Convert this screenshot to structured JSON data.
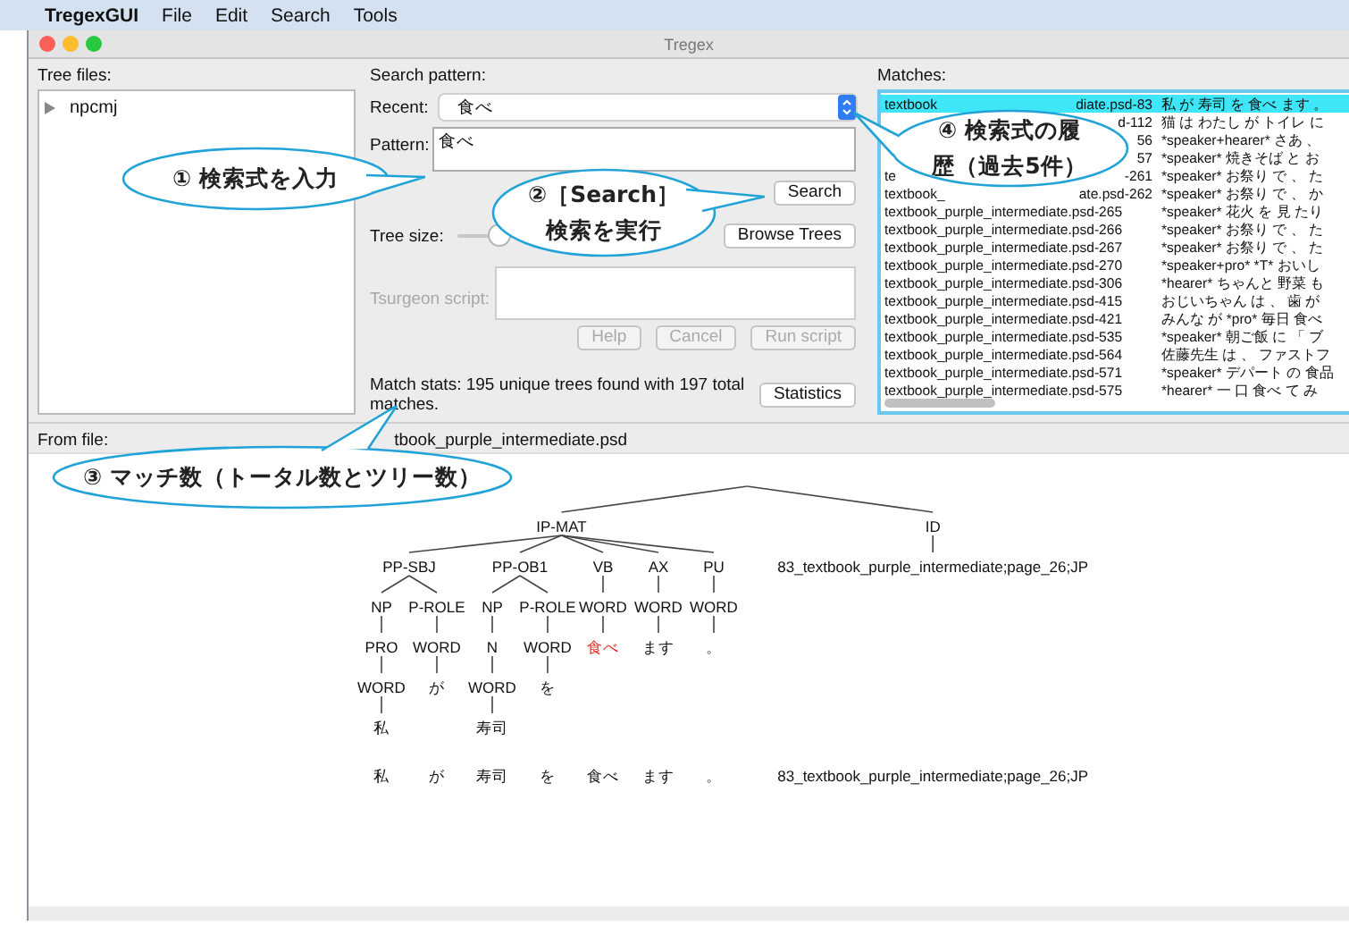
{
  "menu_bar": {
    "app": "TregexGUI",
    "items": [
      "File",
      "Edit",
      "Search",
      "Tools"
    ]
  },
  "window": {
    "title": "Tregex"
  },
  "tree_files": {
    "label": "Tree files:",
    "items": [
      {
        "name": "npcmj",
        "expanded": false
      }
    ]
  },
  "search": {
    "label": "Search pattern:",
    "recent_label": "Recent:",
    "recent_value": "食べ",
    "pattern_label": "Pattern:",
    "pattern_value": "食べ",
    "search_button": "Search",
    "tree_size_label": "Tree size:",
    "tree_size": {
      "level": 0.15
    },
    "browse_button": "Browse Trees",
    "tsurgeon_label": "Tsurgeon script:",
    "tsurgeon_disabled": true,
    "buttons": [
      {
        "label": "Help",
        "disabled": true
      },
      {
        "label": "Cancel",
        "disabled": true
      },
      {
        "label": "Run script",
        "disabled": true
      }
    ],
    "match_stats": "Match stats: 195 unique trees found with 197 total matches.",
    "statistics_button": "Statistics"
  },
  "matches": {
    "label": "Matches:",
    "rows": [
      {
        "head": "textbook",
        "tail": "diate.psd-83",
        "sentence": "私 が 寿司 を 食べ ます 。",
        "selected": true
      },
      {
        "tail": "d-112",
        "sentence": "猫 は わたし が トイレ に",
        "selected": false
      },
      {
        "tail": "56",
        "sentence": "*speaker+hearer* さあ 、",
        "selected": false
      },
      {
        "tail": "57",
        "sentence": "*speaker* 焼きそば と お",
        "selected": false
      },
      {
        "head": "te",
        "tail": "-261",
        "sentence": "*speaker* お祭り で 、 た",
        "selected": false
      },
      {
        "head": "textbook_",
        "tail": "ate.psd-262",
        "sentence": "*speaker* お祭り で 、 か",
        "selected": false
      },
      {
        "file": "textbook_purple_intermediate.psd-265",
        "sentence": "*speaker* 花火 を 見 たり",
        "selected": false
      },
      {
        "file": "textbook_purple_intermediate.psd-266",
        "sentence": "*speaker* お祭り で 、 た",
        "selected": false
      },
      {
        "file": "textbook_purple_intermediate.psd-267",
        "sentence": "*speaker* お祭り で 、 た",
        "selected": false
      },
      {
        "file": "textbook_purple_intermediate.psd-270",
        "sentence": "*speaker+pro* *T* おいし",
        "selected": false
      },
      {
        "file": "textbook_purple_intermediate.psd-306",
        "sentence": "*hearer* ちゃんと 野菜 も",
        "selected": false
      },
      {
        "file": "textbook_purple_intermediate.psd-415",
        "sentence": "おじいちゃん は 、 歯 が",
        "selected": false
      },
      {
        "file": "textbook_purple_intermediate.psd-421",
        "sentence": "みんな が *pro* 毎日 食べ",
        "selected": false
      },
      {
        "file": "textbook_purple_intermediate.psd-535",
        "sentence": "*speaker* 朝ご飯 に 「 ブ",
        "selected": false
      },
      {
        "file": "textbook_purple_intermediate.psd-564",
        "sentence": "佐藤先生 は 、 ファストフ",
        "selected": false
      },
      {
        "file": "textbook_purple_intermediate.psd-571",
        "sentence": "*speaker* デパート の 食品",
        "selected": false
      },
      {
        "file": "textbook_purple_intermediate.psd-575",
        "sentence": "*hearer* 一 口 食べ て み",
        "selected": false
      }
    ]
  },
  "from_file": {
    "label": "From file:",
    "value": "tbook_purple_intermediate.psd"
  },
  "tree": {
    "children": [
      {
        "label": "IP-MAT",
        "children": [
          {
            "label": "PP-SBJ",
            "children": [
              {
                "label": "NP",
                "children": [
                  {
                    "label": "PRO",
                    "children": [
                      {
                        "label": "WORD",
                        "children": [
                          {
                            "label": "私"
                          }
                        ]
                      }
                    ]
                  }
                ]
              },
              {
                "label": "P-ROLE",
                "children": [
                  {
                    "label": "WORD",
                    "children": [
                      {
                        "label": "が"
                      }
                    ]
                  }
                ]
              }
            ]
          },
          {
            "label": "PP-OB1",
            "children": [
              {
                "label": "NP",
                "children": [
                  {
                    "label": "N",
                    "children": [
                      {
                        "label": "WORD",
                        "children": [
                          {
                            "label": "寿司"
                          }
                        ]
                      }
                    ]
                  }
                ]
              },
              {
                "label": "P-ROLE",
                "children": [
                  {
                    "label": "WORD",
                    "children": [
                      {
                        "label": "を"
                      }
                    ]
                  }
                ]
              }
            ]
          },
          {
            "label": "VB",
            "children": [
              {
                "label": "WORD",
                "children": [
                  {
                    "label": "食べ",
                    "highlighted": true
                  }
                ]
              }
            ]
          },
          {
            "label": "AX",
            "children": [
              {
                "label": "WORD",
                "children": [
                  {
                    "label": "ます"
                  }
                ]
              }
            ]
          },
          {
            "label": "PU",
            "children": [
              {
                "label": "WORD",
                "children": [
                  {
                    "label": "。"
                  }
                ]
              }
            ]
          }
        ]
      },
      {
        "label": "ID",
        "children": [
          {
            "label": "83_textbook_purple_intermediate;page_26;JP"
          }
        ]
      }
    ]
  },
  "yield": [
    "私",
    "が",
    "寿司",
    "を",
    "食べ",
    "ます",
    "。",
    "83_textbook_purple_intermediate;page_26;JP"
  ],
  "callouts": [
    {
      "lines": [
        "① 検索式を入力"
      ]
    },
    {
      "lines": [
        "②［Search］",
        "検索を実行"
      ]
    },
    {
      "lines": [
        "③ マッチ数（トータル数とツリー数）"
      ]
    },
    {
      "lines": [
        "④ 検索式の履",
        "歴（過去5件）"
      ]
    }
  ]
}
